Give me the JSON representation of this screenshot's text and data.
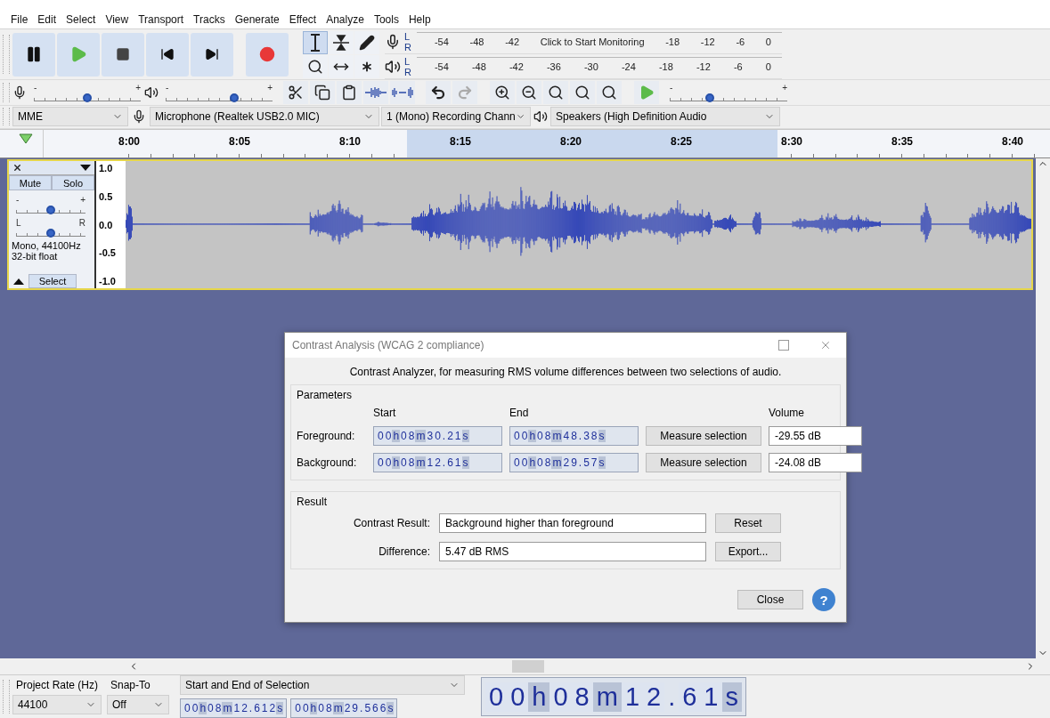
{
  "menu": [
    "File",
    "Edit",
    "Select",
    "View",
    "Transport",
    "Tracks",
    "Generate",
    "Effect",
    "Analyze",
    "Tools",
    "Help"
  ],
  "tools": [
    {
      "kind": "select",
      "selected": true
    },
    {
      "kind": "envelope",
      "selected": false
    },
    {
      "kind": "draw",
      "selected": false
    },
    {
      "kind": "zoom",
      "selected": false
    },
    {
      "kind": "time_shift",
      "selected": false
    },
    {
      "kind": "multi",
      "selected": false
    }
  ],
  "recording_meter": {
    "side_labels": [
      "L",
      "R"
    ],
    "ticks": [
      "-54",
      "-48",
      "-42"
    ],
    "message": "Click to Start Monitoring",
    "ticks_after": [
      "-18",
      "-12",
      "-6",
      "0"
    ]
  },
  "playback_meter": {
    "side_labels": [
      "L",
      "R"
    ],
    "ticks": [
      "-54",
      "-48",
      "-42",
      "-36",
      "-30",
      "-24",
      "-18",
      "-12",
      "-6",
      "0"
    ]
  },
  "mixer": {
    "recording": {
      "low": "-",
      "high": "+",
      "level": 0.5
    },
    "playback": {
      "low": "-",
      "high": "+",
      "level": 0.64
    }
  },
  "play_at_speed": {
    "low": "-",
    "high": "+",
    "level": 0.34
  },
  "devices": {
    "host": "MME",
    "recording_device": "Microphone (Realtek USB2.0 MIC)",
    "channels": "1 (Mono) Recording Chann",
    "playback_device": "Speakers (High Definition Audio"
  },
  "timeline": {
    "ticks": [
      "8:00",
      "8:05",
      "8:10",
      "8:15",
      "8:20",
      "8:25",
      "8:30",
      "8:35",
      "8:40"
    ]
  },
  "track": {
    "mute": "Mute",
    "solo": "Solo",
    "gain": {
      "low": "-",
      "high": "+",
      "level": 0.5
    },
    "pan": {
      "low": "L",
      "high": "R",
      "level": 0.5
    },
    "info": [
      "Mono, 44100Hz",
      "32-bit float"
    ],
    "select": "Select",
    "scale": [
      "1.0",
      "0.5",
      "0.0",
      "-0.5",
      "-1.0"
    ]
  },
  "dialog": {
    "title": "Contrast Analysis (WCAG 2 compliance)",
    "description": "Contrast Analyzer, for measuring RMS volume differences between two selections of audio.",
    "parameters": {
      "legend": "Parameters",
      "columns": [
        "Start",
        "End",
        "Volume"
      ],
      "rows": [
        {
          "label": "Foreground:",
          "start": "00h08m30.21s",
          "end": "00h08m48.38s",
          "button": "Measure selection",
          "volume": "-29.55 dB"
        },
        {
          "label": "Background:",
          "start": "00h08m12.61s",
          "end": "00h08m29.57s",
          "button": "Measure selection",
          "volume": "-24.08 dB"
        }
      ]
    },
    "result": {
      "legend": "Result",
      "rows": [
        {
          "label": "Contrast Result:",
          "value": "Background higher than foreground",
          "button": "Reset"
        },
        {
          "label": "Difference:",
          "value": "5.47 dB RMS",
          "button": "Export..."
        }
      ]
    },
    "close": "Close",
    "help": "?"
  },
  "selection_toolbar": {
    "project_rate": {
      "label": "Project Rate (Hz)",
      "value": "44100"
    },
    "snap_to": {
      "label": "Snap-To",
      "value": "Off"
    },
    "mode": "Start and End of Selection",
    "start": "00h08m12.612s",
    "end": "00h08m29.566s"
  },
  "audio_position": "00h08m12.61s"
}
